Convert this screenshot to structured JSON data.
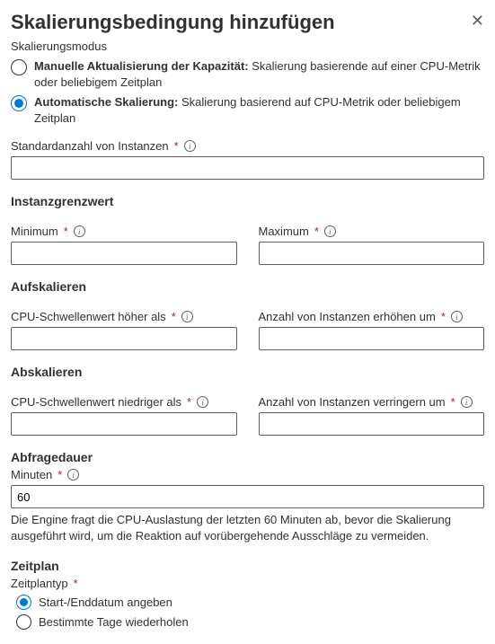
{
  "header": {
    "title": "Skalierungsbedingung hinzufügen"
  },
  "mode": {
    "label": "Skalierungsmodus",
    "option_manual_bold": "Manuelle Aktualisierung der Kapazität:",
    "option_manual_rest": " Skalierung basierende auf einer CPU-Metrik oder beliebigem Zeitplan",
    "option_auto_bold": "Automatische Skalierung:",
    "option_auto_rest": " Skalierung basierend auf CPU-Metrik oder beliebigem Zeitplan"
  },
  "defaultInstances": {
    "label": "Standardanzahl von Instanzen",
    "value": ""
  },
  "limits": {
    "heading": "Instanzgrenzwert",
    "min_label": "Minimum",
    "min_value": "",
    "max_label": "Maximum",
    "max_value": ""
  },
  "scaleOut": {
    "heading": "Aufskalieren",
    "threshold_label": "CPU-Schwellenwert höher als",
    "threshold_value": "",
    "increase_label": "Anzahl von Instanzen erhöhen um",
    "increase_value": ""
  },
  "scaleIn": {
    "heading": "Abskalieren",
    "threshold_label": "CPU-Schwellenwert niedriger als",
    "threshold_value": "",
    "decrease_label": "Anzahl von Instanzen verringern um",
    "decrease_value": ""
  },
  "query": {
    "heading": "Abfragedauer",
    "minutes_label": "Minuten",
    "minutes_value": "60",
    "help": "Die Engine fragt die CPU-Auslastung der letzten 60 Minuten ab, bevor die Skalierung ausgeführt wird, um die Reaktion auf vorübergehende Ausschläge zu vermeiden."
  },
  "schedule": {
    "heading": "Zeitplan",
    "type_label": "Zeitplantyp",
    "option_startend": "Start-/Enddatum angeben",
    "option_repeat": "Bestimmte Tage wiederholen"
  }
}
